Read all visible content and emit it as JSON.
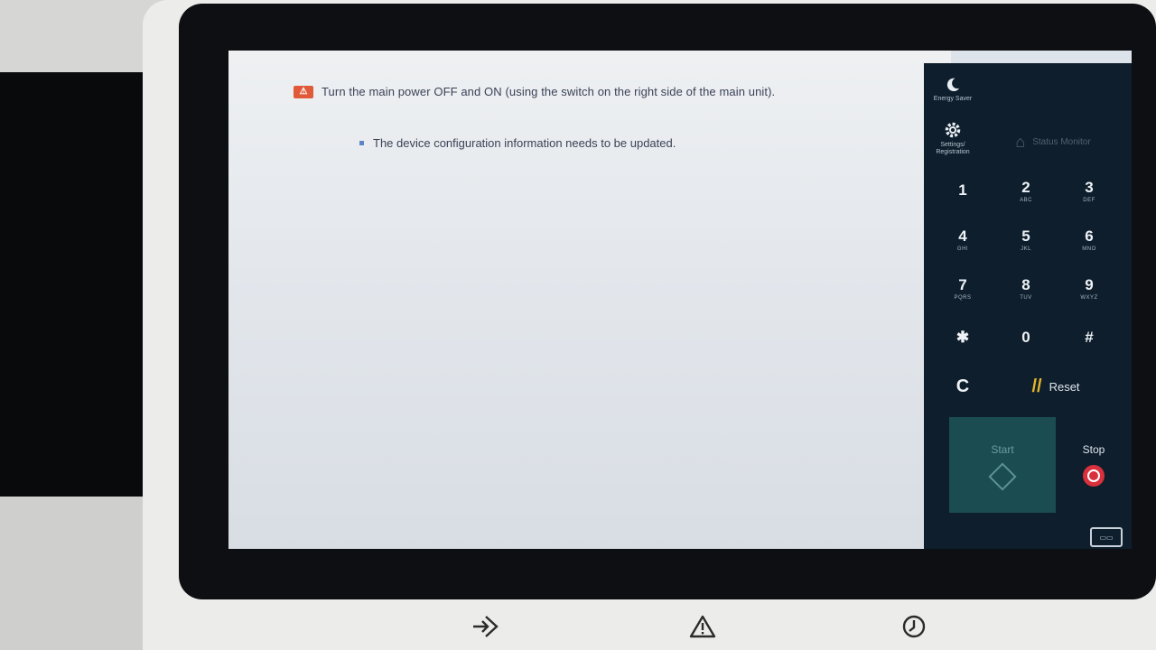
{
  "message": {
    "warning": "Turn the main power OFF and ON (using the switch on the right side of the main unit).",
    "detail": "The device configuration information needs to be updated."
  },
  "side_panel": {
    "energy_saver": "Energy Saver",
    "settings": "Settings/ Registration",
    "status": "Status Monitor",
    "keys": [
      {
        "num": "1",
        "sub": ""
      },
      {
        "num": "2",
        "sub": "ABC"
      },
      {
        "num": "3",
        "sub": "DEF"
      },
      {
        "num": "4",
        "sub": "GHI"
      },
      {
        "num": "5",
        "sub": "JKL"
      },
      {
        "num": "6",
        "sub": "MNO"
      },
      {
        "num": "7",
        "sub": "PQRS"
      },
      {
        "num": "8",
        "sub": "TUV"
      },
      {
        "num": "9",
        "sub": "WXYZ"
      },
      {
        "num": "✱",
        "sub": ""
      },
      {
        "num": "0",
        "sub": ""
      },
      {
        "num": "#",
        "sub": ""
      }
    ],
    "clear": "C",
    "reset": "Reset",
    "start": "Start",
    "stop": "Stop"
  },
  "colors": {
    "warning_icon": "#e05a3a",
    "panel_bg": "#0e1e2c",
    "start_bg": "#1a4c52",
    "stop_icon": "#d8303c",
    "reset_accent": "#e6b62a"
  }
}
